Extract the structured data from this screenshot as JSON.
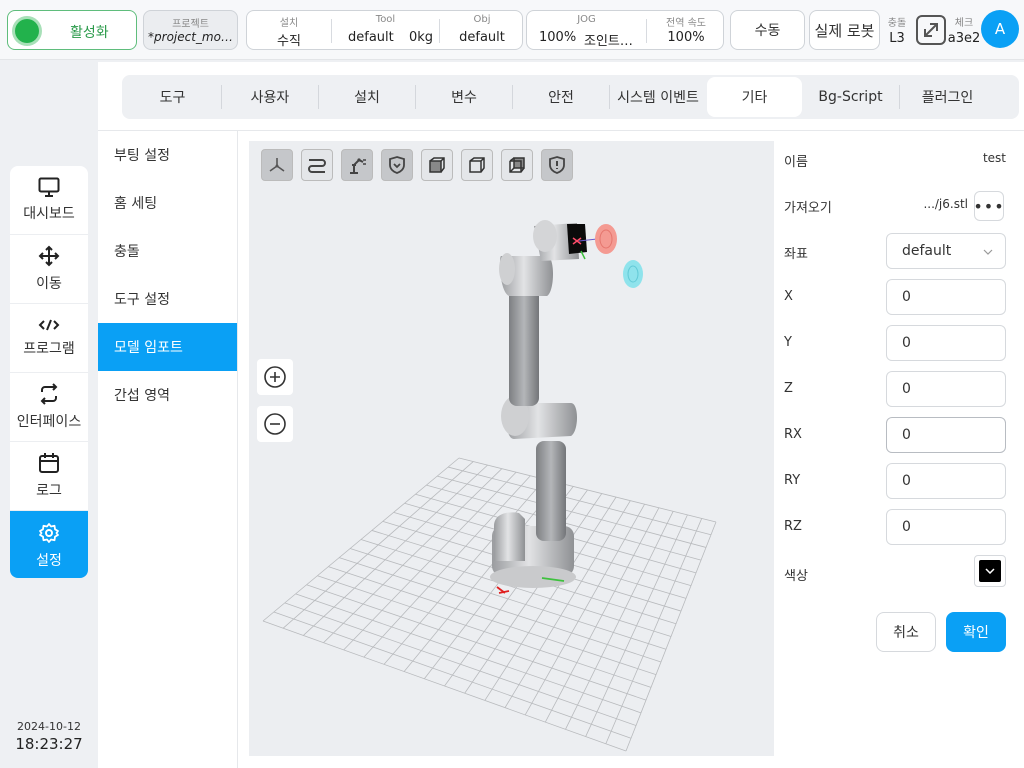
{
  "topbar": {
    "activate_label": "활성화",
    "project": {
      "label": "프로젝트",
      "value": "*project_mo…"
    },
    "install": {
      "label": "설치",
      "value": "수직"
    },
    "tool": {
      "label": "Tool",
      "name": "default",
      "weight": "0kg"
    },
    "obj": {
      "label": "Obj",
      "value": "default"
    },
    "jog": {
      "label": "JOG",
      "percent": "100%",
      "mode": "조인트…"
    },
    "global_speed": {
      "label": "전역 속도",
      "value": "100%"
    },
    "manual_label": "수동",
    "real_robot_label": "실제 로봇",
    "collision": {
      "label": "충돌",
      "value": "L3"
    },
    "check": {
      "label": "체크",
      "value": "a3e2"
    },
    "avatar": "A"
  },
  "sidebar": {
    "items": [
      {
        "label": "대시보드",
        "icon": "monitor-icon"
      },
      {
        "label": "이동",
        "icon": "move-arrows-icon"
      },
      {
        "label": "프로그램",
        "icon": "code-icon"
      },
      {
        "label": "인터페이스",
        "icon": "swap-icon"
      },
      {
        "label": "로그",
        "icon": "calendar-icon"
      },
      {
        "label": "설정",
        "icon": "gear-icon"
      }
    ],
    "date": "2024-10-12",
    "time": "18:23:27"
  },
  "tabs": [
    "도구",
    "사용자",
    "설치",
    "변수",
    "안전",
    "시스템 이벤트",
    "기타",
    "Bg-Script",
    "플러그인"
  ],
  "active_tab": "기타",
  "submenu": [
    "부팅 설정",
    "홈 세팅",
    "충돌",
    "도구 설정",
    "모델 임포트",
    "간섭 영역"
  ],
  "active_submenu": "모델 임포트",
  "viewport_toolbar": [
    "axis-view-icon",
    "path-icon",
    "robot-arm-icon",
    "shield-check-icon",
    "cube-front-icon",
    "cube-side-icon",
    "cube-back-icon",
    "shield-alert-icon"
  ],
  "form": {
    "name_label": "이름",
    "name_value": "test",
    "import_label": "가져오기",
    "import_value": ".../j6.stl",
    "coord_label": "좌표",
    "coord_value": "default",
    "x_label": "X",
    "x_value": "0",
    "y_label": "Y",
    "y_value": "0",
    "z_label": "Z",
    "z_value": "0",
    "rx_label": "RX",
    "rx_value": "0",
    "ry_label": "RY",
    "ry_value": "0",
    "rz_label": "RZ",
    "rz_value": "0",
    "color_label": "색상",
    "color_value": "#000000",
    "cancel_label": "취소",
    "confirm_label": "확인"
  },
  "colors": {
    "accent": "#0aa0f5",
    "active_green": "#22b24c"
  }
}
